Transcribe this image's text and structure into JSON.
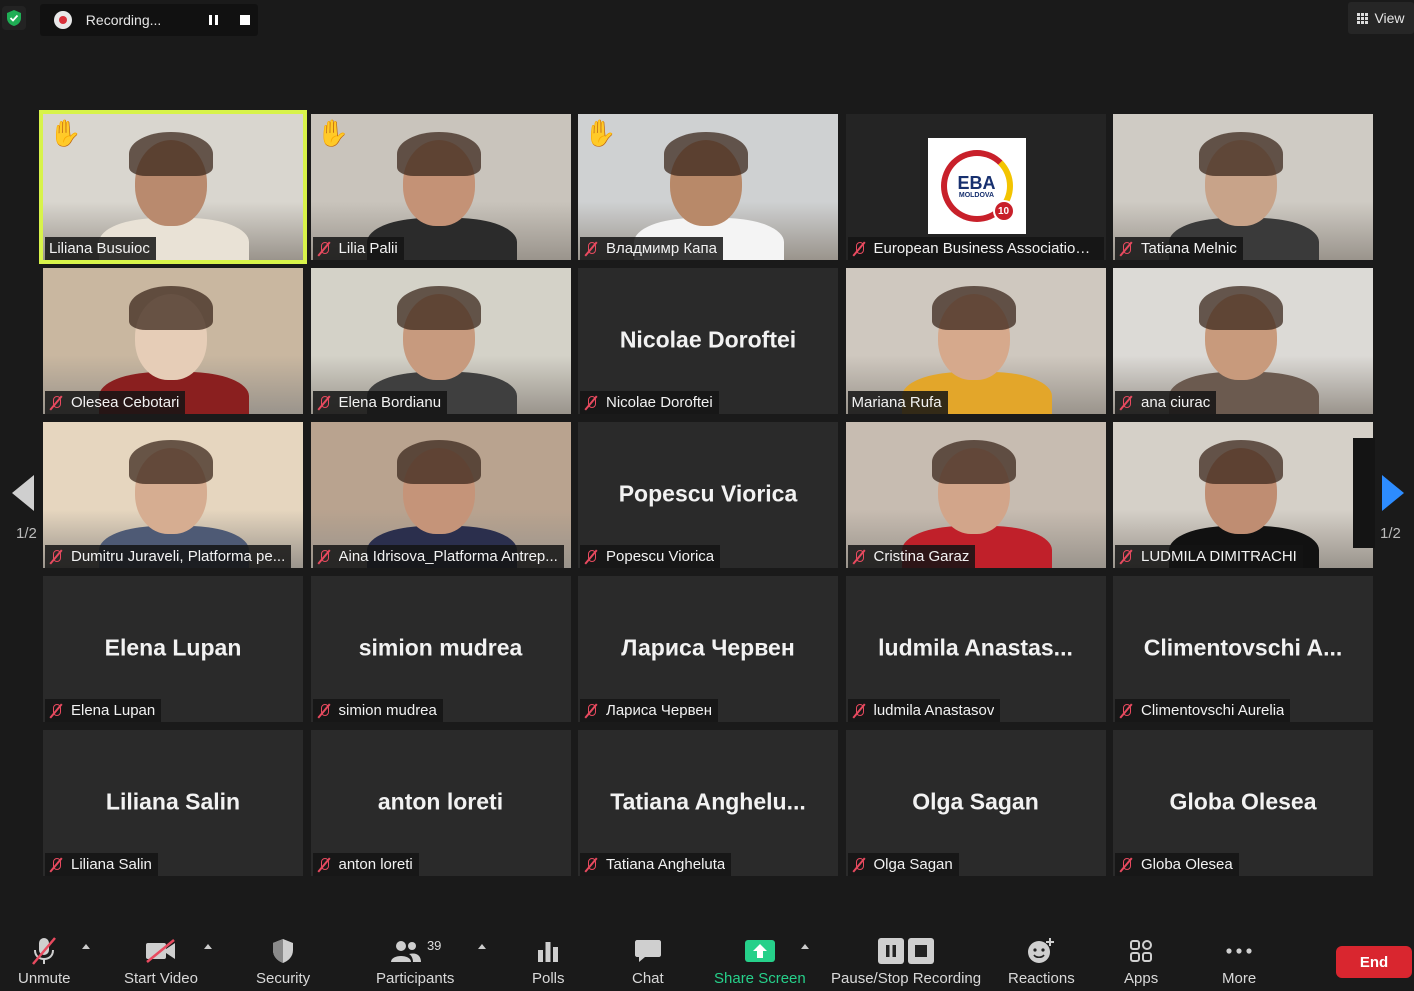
{
  "topbar": {
    "recording_text": "Recording...",
    "view_label": "View"
  },
  "tiles": [
    {
      "name": "Liliana Busuioc",
      "big": "",
      "video": true,
      "hand": true,
      "muted": false,
      "active": true
    },
    {
      "name": "Lilia Palii",
      "big": "",
      "video": true,
      "hand": true,
      "muted": true
    },
    {
      "name": "Владмимр Капа",
      "big": "",
      "video": true,
      "hand": true,
      "muted": true
    },
    {
      "name": "European Business Association ...",
      "big": "",
      "video": true,
      "logo": true,
      "muted": true
    },
    {
      "name": "Tatiana Melnic",
      "big": "",
      "video": true,
      "muted": true
    },
    {
      "name": "Olesea Cebotari",
      "big": "",
      "video": true,
      "muted": true
    },
    {
      "name": "Elena Bordianu",
      "big": "",
      "video": true,
      "muted": true
    },
    {
      "name": "Nicolae Doroftei",
      "big": "Nicolae Doroftei",
      "video": false,
      "muted": true
    },
    {
      "name": "Mariana Rufa",
      "big": "",
      "video": true,
      "muted": false
    },
    {
      "name": "ana ciurac",
      "big": "",
      "video": true,
      "muted": true
    },
    {
      "name": "Dumitru Juraveli, Platforma pe...",
      "big": "",
      "video": true,
      "muted": true
    },
    {
      "name": "Aina Idrisova_Platforma Antrep...",
      "big": "",
      "video": true,
      "muted": true
    },
    {
      "name": "Popescu Viorica",
      "big": "Popescu Viorica",
      "video": false,
      "muted": true
    },
    {
      "name": "Cristina Garaz",
      "big": "",
      "video": true,
      "muted": true
    },
    {
      "name": "LUDMILA DIMITRACHI",
      "big": "",
      "video": true,
      "muted": true
    },
    {
      "name": "Elena Lupan",
      "big": "Elena Lupan",
      "video": false,
      "muted": true
    },
    {
      "name": "simion mudrea",
      "big": "simion mudrea",
      "video": false,
      "muted": true
    },
    {
      "name": "Лариса Червен",
      "big": "Лариса Червен",
      "video": false,
      "muted": true
    },
    {
      "name": "ludmila Anastasov",
      "big": "ludmila  Anastas...",
      "video": false,
      "muted": true
    },
    {
      "name": "Climentovschi Aurelia",
      "big": "Climentovschi  A...",
      "video": false,
      "muted": true
    },
    {
      "name": "Liliana Salin",
      "big": "Liliana Salin",
      "video": false,
      "muted": true
    },
    {
      "name": "anton loreti",
      "big": "anton loreti",
      "video": false,
      "muted": true
    },
    {
      "name": "Tatiana Angheluta",
      "big": "Tatiana  Anghelu...",
      "video": false,
      "muted": true
    },
    {
      "name": "Olga Sagan",
      "big": "Olga Sagan",
      "video": false,
      "muted": true
    },
    {
      "name": "Globa Olesea",
      "big": "Globa Olesea",
      "video": false,
      "muted": true
    }
  ],
  "logo_text": {
    "main": "EBA",
    "sub": "MOLDOVA",
    "badge": "10"
  },
  "pager": {
    "left": "1/2",
    "right": "1/2"
  },
  "toolbar": {
    "unmute": "Unmute",
    "start_video": "Start Video",
    "security": "Security",
    "participants": "Participants",
    "participants_count": "39",
    "polls": "Polls",
    "chat": "Chat",
    "share_screen": "Share Screen",
    "pause_stop": "Pause/Stop Recording",
    "reactions": "Reactions",
    "apps": "Apps",
    "more": "More",
    "end": "End"
  },
  "colors": {
    "active_border": "#d8f34a",
    "share_green": "#26d08a",
    "end_red": "#d9262f",
    "muted_red": "#e84a5f",
    "nav_blue": "#2d8cff"
  }
}
